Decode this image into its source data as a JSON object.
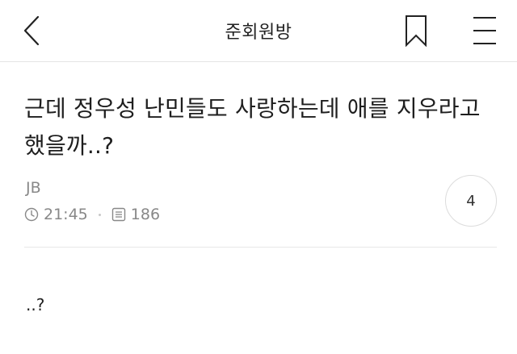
{
  "header": {
    "title": "준회원방",
    "back_icon": "chevron-left-icon",
    "bookmark_icon": "bookmark-icon",
    "menu_icon": "hamburger-menu-icon"
  },
  "post": {
    "title": "근데 정우성 난민들도 사랑하는데 애를 지우라고 했을까..?",
    "author": "JB",
    "time": "21:45",
    "views": "186",
    "comment_count": "4",
    "body": "..?"
  },
  "colors": {
    "text": "#222222",
    "meta": "#888888",
    "divider": "#e8e8e8"
  }
}
